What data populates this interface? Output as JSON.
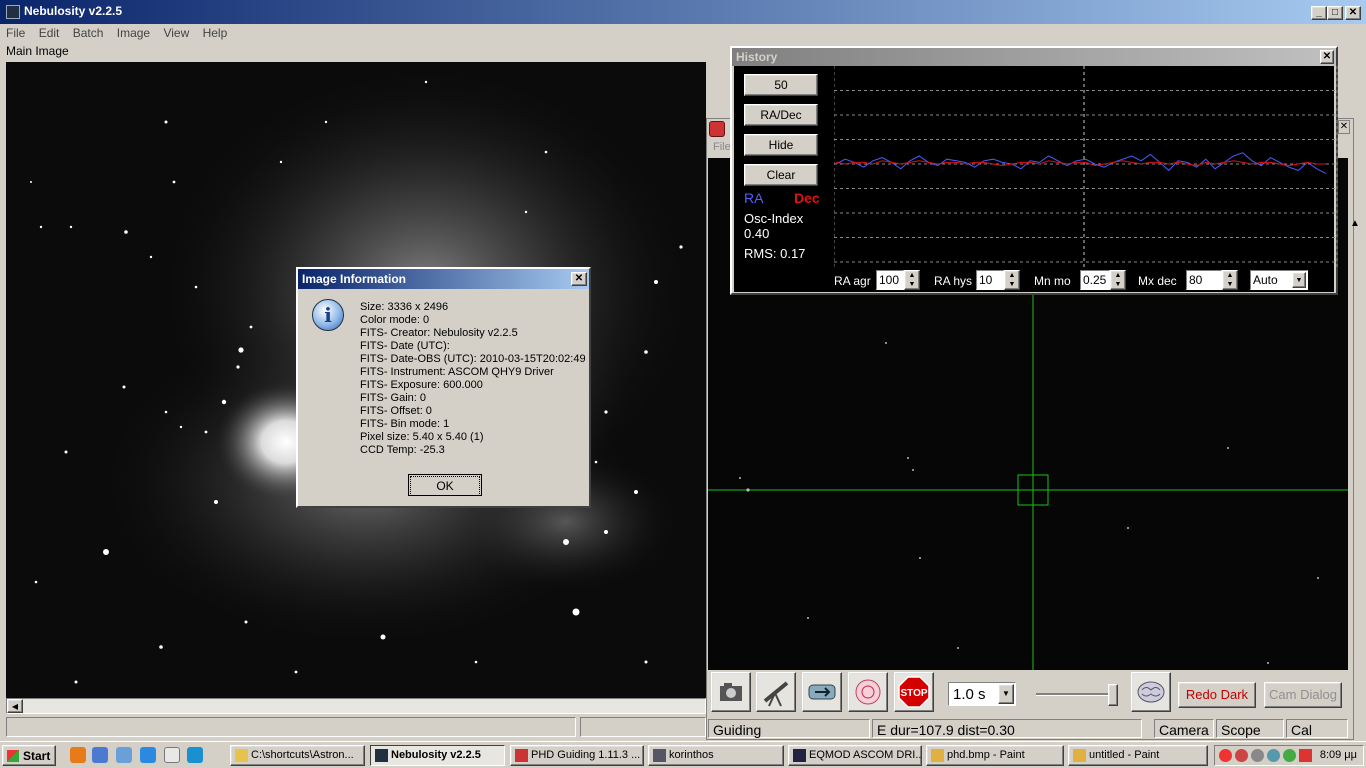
{
  "main_window": {
    "title": "Nebulosity v2.2.5",
    "menu": [
      "File",
      "Edit",
      "Batch",
      "Image",
      "View",
      "Help"
    ],
    "panel_label": "Main Image",
    "controls": {
      "minimize": "_",
      "maximize": "□",
      "close": "✕"
    }
  },
  "dialog": {
    "title": "Image Information",
    "close": "✕",
    "icon": "info-icon",
    "icon_glyph": "i",
    "lines": [
      "Size: 3336 x 2496",
      "Color mode: 0",
      "FITS- Creator: Nebulosity v2.2.5",
      "FITS- Date (UTC):",
      "FITS- Date-OBS (UTC): 2010-03-15T20:02:49",
      "FITS- Instrument: ASCOM QHY9 Driver",
      "FITS- Exposure: 600.000",
      "FITS- Gain: 0",
      "FITS- Offset: 0",
      "FITS- Bin mode: 1",
      "Pixel size: 5.40 x 5.40 (1)",
      "CCD Temp: -25.3"
    ],
    "ok_label": "OK"
  },
  "history": {
    "title": "History",
    "close": "✕",
    "buttons": [
      "50",
      "RA/Dec",
      "Hide",
      "Clear"
    ],
    "legend_ra": "RA",
    "legend_dec": "Dec",
    "osc_label": "Osc-Index",
    "osc_value": "0.40",
    "rms": "RMS: 0.17",
    "controls": [
      {
        "label": "RA agr",
        "value": "100"
      },
      {
        "label": "RA hys",
        "value": "10"
      },
      {
        "label": "Mn mo",
        "value": "0.25"
      },
      {
        "label": "Mx dec",
        "value": "80"
      }
    ],
    "mode_select": "Auto",
    "colors": {
      "ra": "#4a5cff",
      "dec": "#e01010"
    },
    "ra_trace": [
      0,
      0.3,
      0.1,
      -0.2,
      0.2,
      0.4,
      0.1,
      -0.3,
      0.2,
      0.5,
      0.1,
      -0.1,
      0.3,
      0.2,
      0.1,
      -0.2,
      0.2,
      0.3,
      0.1,
      0,
      -0.3,
      0.2,
      0.1,
      0.5,
      0.2,
      -0.1,
      0.2,
      0.3,
      0,
      -0.2,
      0.1,
      0.3,
      0.5,
      0.2,
      0.6,
      0.1,
      -0.4,
      0.2,
      0.1,
      -0.2,
      0.3,
      -0.3,
      0.1,
      0.5,
      0.7,
      0.2,
      -0.1,
      0.4,
      0.1,
      -0.2,
      -0.4,
      0.1,
      -0.3,
      -0.6
    ],
    "dec_trace": [
      0.1,
      0,
      0.1,
      0.1,
      0,
      0.2,
      0.1,
      0,
      0.1,
      0.2,
      0.1,
      0,
      0.1,
      0.1,
      0,
      0.1,
      0.1,
      0,
      -0.1,
      0,
      0.1,
      0.1,
      0,
      0.2,
      0.1,
      0,
      0.1,
      0.1,
      -0.1,
      0,
      0.1,
      0.2,
      0.1,
      0,
      0.1,
      0.1,
      0,
      0.1,
      0,
      -0.1,
      0.1,
      0,
      0.1,
      0.2,
      0.1,
      0,
      0.1,
      0.1,
      0,
      -0.1,
      0,
      0.1,
      0,
      0
    ]
  },
  "phd": {
    "menu_fragment": "File",
    "toolbar": {
      "exposure": "1.0 s",
      "redo_dark": "Redo Dark",
      "cam_dialog": "Cam Dialog",
      "icons": [
        "camera-icon",
        "telescope-icon",
        "loop-icon",
        "brain-guide-icon",
        "stop-icon",
        "brain-icon"
      ],
      "stop_glyph": "STOP"
    },
    "status": {
      "mode": "Guiding",
      "info": "E dur=107.9 dist=0.30",
      "camera": "Camera",
      "scope": "Scope",
      "cal": "Cal"
    }
  },
  "taskbar": {
    "start": "Start",
    "tasks": [
      {
        "label": "C:\\shortcuts\\Astron...",
        "icon": "folder-icon",
        "active": false
      },
      {
        "label": "Nebulosity v2.2.5",
        "icon": "nebulosity-icon",
        "active": true
      },
      {
        "label": "PHD Guiding 1.11.3 ...",
        "icon": "phd-icon",
        "active": false
      },
      {
        "label": "korinthos",
        "icon": "app-icon",
        "active": false
      },
      {
        "label": "EQMOD ASCOM DRI...",
        "icon": "eqmod-icon",
        "active": false
      },
      {
        "label": "phd.bmp - Paint",
        "icon": "paint-icon",
        "active": false
      },
      {
        "label": "untitled - Paint",
        "icon": "paint-icon",
        "active": false
      }
    ],
    "clock": "8:09 μμ"
  }
}
